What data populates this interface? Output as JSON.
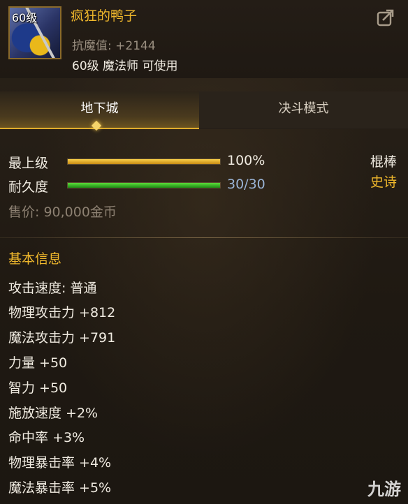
{
  "item": {
    "level_badge": "60级",
    "name": "疯狂的鸭子",
    "magic_defense_label": "抗魔值:",
    "magic_defense_value": "+2144",
    "requirement": "60级 魔法师 可使用"
  },
  "tabs": [
    {
      "label": "地下城",
      "active": true
    },
    {
      "label": "决斗模式",
      "active": false
    }
  ],
  "stats": {
    "enhance_label": "最上级",
    "enhance_percent": "100%",
    "enhance_fraction": 1.0,
    "durability_label": "耐久度",
    "durability_value": "30/30",
    "durability_fraction": 1.0,
    "weapon_type": "棍棒",
    "rarity": "史诗",
    "price": "售价: 90,000金币"
  },
  "colors": {
    "rarity": "#f0b82c",
    "item_name": "#f0b82c",
    "durability_text": "#9ab4d6"
  },
  "basic_info": {
    "title": "基本信息",
    "lines": [
      "攻击速度: 普通",
      "物理攻击力 +812",
      "魔法攻击力 +791",
      "力量 +50",
      "智力 +50",
      "施放速度 +2%",
      "命中率 +3%",
      "物理暴击率 +4%",
      "魔法暴击率 +5%"
    ]
  },
  "icons": {
    "export": "share-export-icon",
    "item": "staff-item-icon"
  },
  "watermark": "九游"
}
